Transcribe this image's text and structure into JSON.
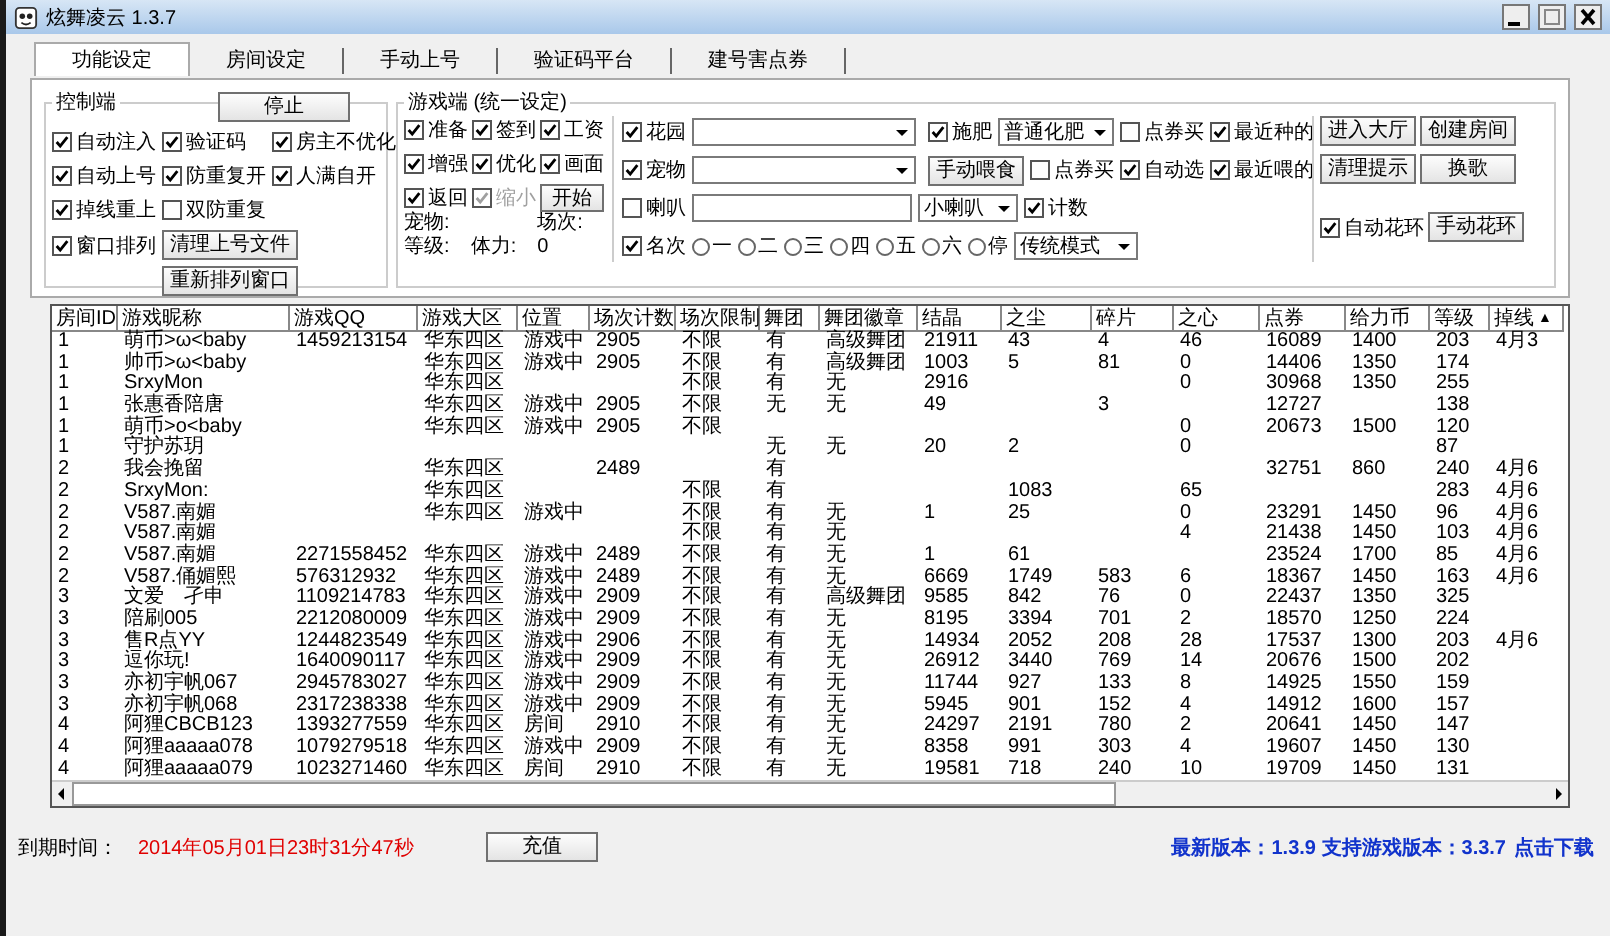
{
  "window": {
    "title": "炫舞凌云 1.3.7"
  },
  "tabs": [
    {
      "label": "功能设定",
      "selected": true
    },
    {
      "label": "房间设定",
      "selected": false
    },
    {
      "label": "手动上号",
      "selected": false
    },
    {
      "label": "验证码平台",
      "selected": false
    },
    {
      "label": "建号害点券",
      "selected": false
    }
  ],
  "control_group": {
    "title": "控制端",
    "stop_button": "停止",
    "checkboxes": [
      {
        "label": "自动注入",
        "checked": true
      },
      {
        "label": "验证码",
        "checked": true
      },
      {
        "label": "房主不优化",
        "checked": true
      },
      {
        "label": "自动上号",
        "checked": true
      },
      {
        "label": "防重复开",
        "checked": true
      },
      {
        "label": "人满自开",
        "checked": true
      },
      {
        "label": "掉线重上",
        "checked": true
      },
      {
        "label": "双防重复",
        "checked": false
      },
      {
        "label": "窗口排列",
        "checked": true
      }
    ],
    "buttons": [
      "清理上号文件",
      "重新排列窗口"
    ]
  },
  "game_group": {
    "title": "游戏端 (统一设定)",
    "basic_checks": [
      {
        "label": "准备",
        "checked": true,
        "disabled": false
      },
      {
        "label": "签到",
        "checked": true,
        "disabled": false
      },
      {
        "label": "工资",
        "checked": true,
        "disabled": false
      },
      {
        "label": "增强",
        "checked": true,
        "disabled": false
      },
      {
        "label": "优化",
        "checked": true,
        "disabled": false
      },
      {
        "label": "画面",
        "checked": true,
        "disabled": false
      },
      {
        "label": "返回",
        "checked": true,
        "disabled": false
      },
      {
        "label": "缩小",
        "checked": true,
        "disabled": true
      }
    ],
    "start_button": "开始",
    "stats": [
      "宠物:",
      "场次:",
      "等级:",
      "体力:",
      "0"
    ],
    "garden": {
      "label": "花园",
      "checked": true
    },
    "fertilize": {
      "label": "施肥",
      "checked": true,
      "value": "普通化肥"
    },
    "garden_coupon": {
      "label": "点券买",
      "checked": false
    },
    "recent_planted": {
      "label": "最近种的",
      "checked": true
    },
    "pet": {
      "label": "宠物",
      "checked": true
    },
    "feed_button": "手动喂食",
    "pet_coupon": {
      "label": "点券买",
      "checked": false
    },
    "auto_pick": {
      "label": "自动选",
      "checked": true
    },
    "recent_fed": {
      "label": "最近喂的",
      "checked": true
    },
    "horn": {
      "label": "喇叭",
      "checked": false
    },
    "horn_type": "小喇叭",
    "count": {
      "label": "计数",
      "checked": true
    },
    "rank": {
      "label": "名次",
      "checked": true
    },
    "rank_options": [
      {
        "label": "一",
        "selected": false
      },
      {
        "label": "二",
        "selected": false
      },
      {
        "label": "三",
        "selected": false
      },
      {
        "label": "四",
        "selected": false
      },
      {
        "label": "五",
        "selected": false
      },
      {
        "label": "六",
        "selected": false
      },
      {
        "label": "停",
        "selected": false
      }
    ],
    "mode": "传统模式",
    "side_buttons": [
      "进入大厅",
      "创建房间",
      "清理提示",
      "换歌"
    ],
    "auto_wreath": {
      "label": "自动花环",
      "checked": true
    },
    "wreath_button": "手动花环"
  },
  "table": {
    "columns": [
      "房间ID",
      "游戏昵称",
      "游戏QQ",
      "游戏大区",
      "位置",
      "场次计数",
      "场次限制",
      "舞团",
      "舞团徽章",
      "结晶",
      "之尘",
      "碎片",
      "之心",
      "点券",
      "给力币",
      "等级",
      "掉线"
    ],
    "sort_mark": "▲",
    "rows": [
      [
        "1",
        "萌币>ω<baby",
        "1459213154",
        "华东四区",
        "游戏中",
        "2905",
        "不限",
        "有",
        "高级舞团",
        "21911",
        "43",
        "4",
        "46",
        "16089",
        "1400",
        "203",
        "4月3"
      ],
      [
        "1",
        "帅币>ω<baby",
        null,
        "华东四区",
        "游戏中",
        "2905",
        "不限",
        "有",
        "高级舞团",
        "1003",
        "5",
        "81",
        "0",
        "14406",
        "1350",
        "174",
        null
      ],
      [
        "1",
        "SrxyMon",
        null,
        "华东四区",
        null,
        null,
        "不限",
        "有",
        "无",
        "2916",
        null,
        null,
        "0",
        "30968",
        "1350",
        "255",
        null
      ],
      [
        "1",
        "张惠香陪唐",
        null,
        "华东四区",
        "游戏中",
        "2905",
        "不限",
        "无",
        "无",
        "49",
        null,
        "3",
        null,
        "12727",
        null,
        "138",
        null
      ],
      [
        "1",
        "萌币>o<baby",
        null,
        "华东四区",
        "游戏中",
        "2905",
        "不限",
        null,
        null,
        null,
        null,
        null,
        "0",
        "20673",
        "1500",
        "120",
        null
      ],
      [
        "1",
        "守护苏玥",
        null,
        null,
        null,
        null,
        null,
        "无",
        "无",
        "20",
        "2",
        null,
        "0",
        null,
        null,
        "87",
        null
      ],
      [
        "2",
        "我会挽留",
        null,
        "华东四区",
        null,
        "2489",
        null,
        "有",
        null,
        null,
        null,
        null,
        null,
        "32751",
        "860",
        "240",
        "4月6"
      ],
      [
        "2",
        "SrxyMon:",
        null,
        "华东四区",
        null,
        null,
        "不限",
        "有",
        null,
        null,
        "1083",
        null,
        "65",
        null,
        null,
        "283",
        "4月6"
      ],
      [
        "2",
        "V587.南媚",
        null,
        "华东四区",
        "游戏中",
        null,
        "不限",
        "有",
        "无",
        "1",
        "25",
        null,
        "0",
        "23291",
        "1450",
        "96",
        "4月6"
      ],
      [
        "2",
        "V587.南媚",
        null,
        null,
        null,
        null,
        "不限",
        "有",
        "无",
        null,
        null,
        null,
        "4",
        "21438",
        "1450",
        "103",
        "4月6"
      ],
      [
        "2",
        "V587.南媚",
        "2271558452",
        "华东四区",
        "游戏中",
        "2489",
        "不限",
        "有",
        "无",
        "1",
        "61",
        null,
        null,
        "23524",
        "1700",
        "85",
        "4月6"
      ],
      [
        "2",
        "V587.俑媚熙",
        "576312932",
        "华东四区",
        "游戏中",
        "2489",
        "不限",
        "有",
        "无",
        "6669",
        "1749",
        "583",
        "6",
        "18367",
        "1450",
        "163",
        "4月6"
      ],
      [
        "3",
        "文爱　孑申",
        "1109214783",
        "华东四区",
        "游戏中",
        "2909",
        "不限",
        "有",
        "高级舞团",
        "9585",
        "842",
        "76",
        "0",
        "22437",
        "1350",
        "325",
        null
      ],
      [
        "3",
        "陪刷005",
        "2212080009",
        "华东四区",
        "游戏中",
        "2909",
        "不限",
        "有",
        "无",
        "8195",
        "3394",
        "701",
        "2",
        "18570",
        "1250",
        "224",
        null
      ],
      [
        "3",
        "售R点YY",
        "1244823549",
        "华东四区",
        "游戏中",
        "2906",
        "不限",
        "有",
        "无",
        "14934",
        "2052",
        "208",
        "28",
        "17537",
        "1300",
        "203",
        "4月6"
      ],
      [
        "3",
        "逗你玩!",
        "1640090117",
        "华东四区",
        "游戏中",
        "2909",
        "不限",
        "有",
        "无",
        "26912",
        "3440",
        "769",
        "14",
        "20676",
        "1500",
        "202",
        null
      ],
      [
        "3",
        "亦初宇帆067",
        "2945783027",
        "华东四区",
        "游戏中",
        "2909",
        "不限",
        "有",
        "无",
        "11744",
        "927",
        "133",
        "8",
        "14925",
        "1550",
        "159",
        null
      ],
      [
        "3",
        "亦初宇帆068",
        "2317238338",
        "华东四区",
        "游戏中",
        "2909",
        "不限",
        "有",
        "无",
        "5945",
        "901",
        "152",
        "4",
        "14912",
        "1600",
        "157",
        null
      ],
      [
        "4",
        "阿狸CBCB123",
        "1393277559",
        "华东四区",
        "房间",
        "2910",
        "不限",
        "有",
        "无",
        "24297",
        "2191",
        "780",
        "2",
        "20641",
        "1450",
        "147",
        null
      ],
      [
        "4",
        "阿狸aaaaa078",
        "1079279518",
        "华东四区",
        "游戏中",
        "2909",
        "不限",
        "有",
        "无",
        "8358",
        "991",
        "303",
        "4",
        "19607",
        "1450",
        "130",
        null
      ],
      [
        "4",
        "阿狸aaaaa079",
        "1023271460",
        "华东四区",
        "房间",
        "2910",
        "不限",
        "有",
        "无",
        "19581",
        "718",
        "240",
        "10",
        "19709",
        "1450",
        "131",
        null
      ]
    ]
  },
  "footer": {
    "expiry_label": "到期时间：",
    "expiry": "2014年05月01日23时31分47秒",
    "recharge_button": "充值",
    "version_text": "最新版本：1.3.9 支持游戏版本：3.3.7",
    "download_link": "点击下载"
  }
}
